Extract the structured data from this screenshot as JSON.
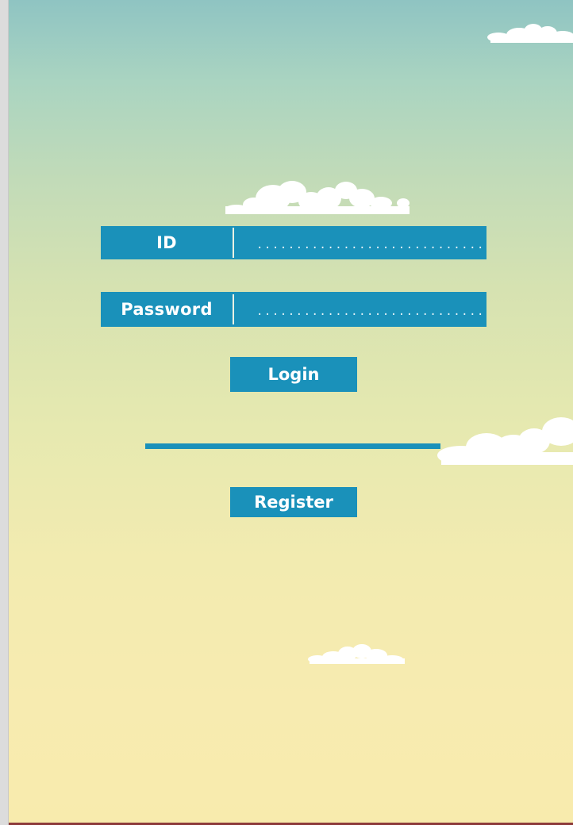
{
  "login_form": {
    "id_label": "ID",
    "id_placeholder": "..............................",
    "id_value": "",
    "password_label": "Password",
    "password_placeholder": "..............................",
    "password_value": "",
    "login_label": "Login",
    "register_label": "Register"
  },
  "colors": {
    "accent": "#1a91ba",
    "sky_top": "#8fc4c2",
    "sky_bottom": "#f8ebad",
    "bottom_bar": "#8d3b3b",
    "cloud": "#ffffff"
  },
  "icons": [
    "cloud-icon"
  ]
}
